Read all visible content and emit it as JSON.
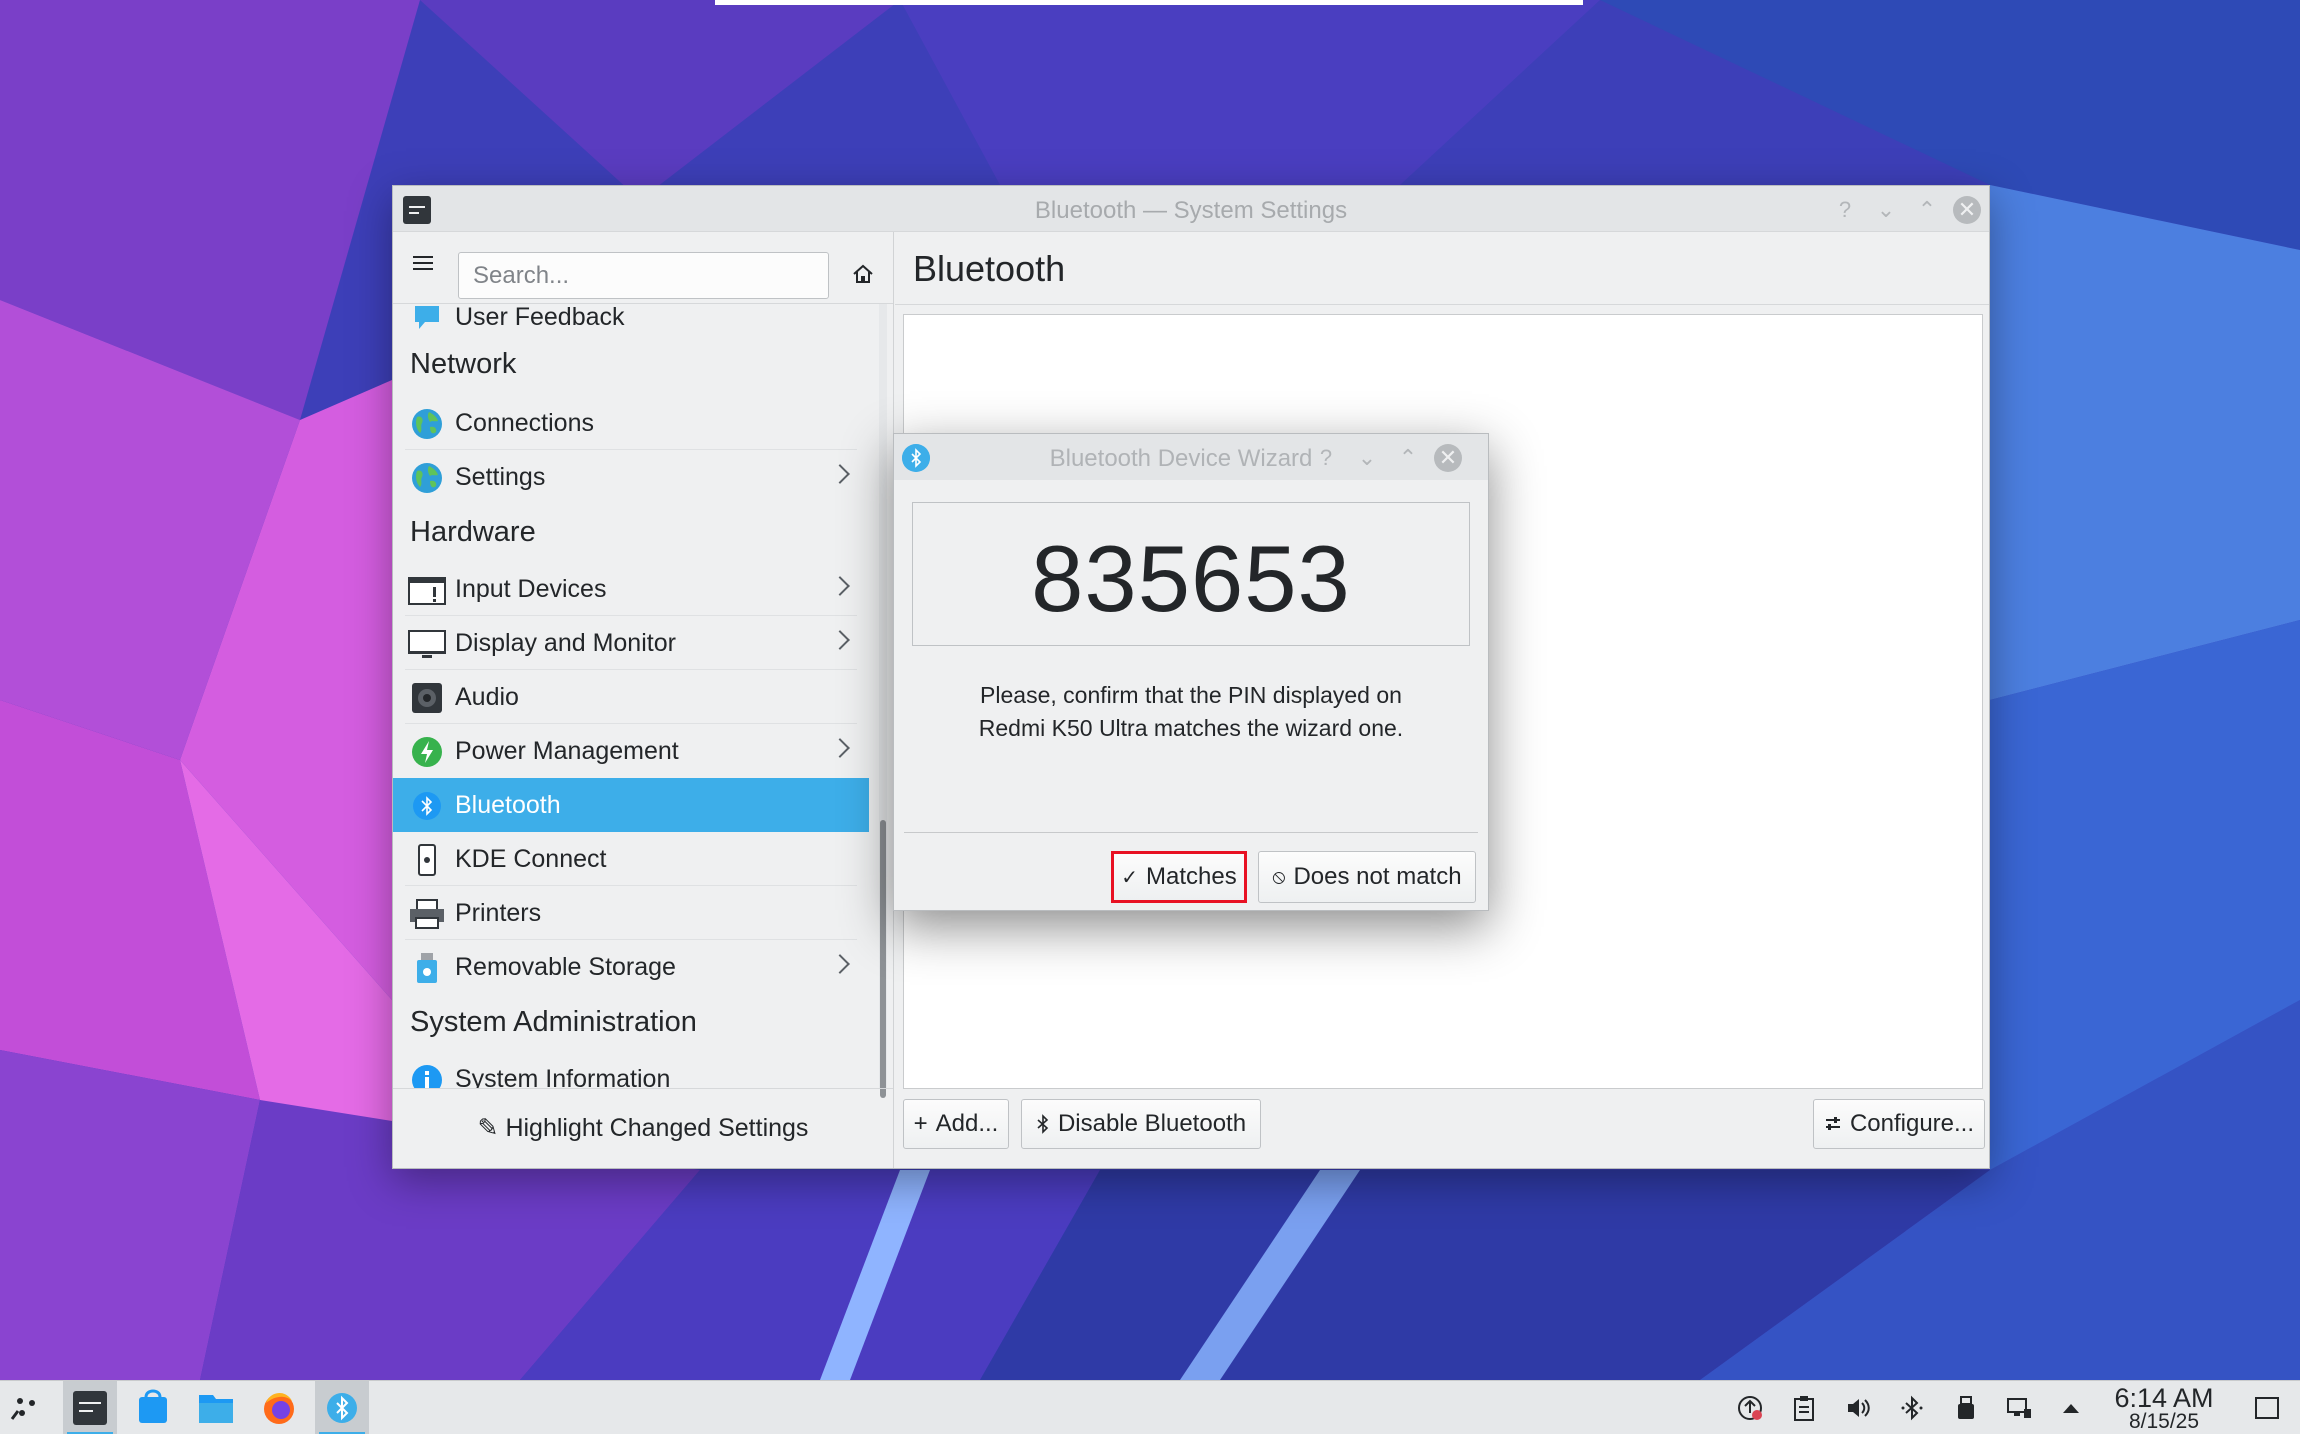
{
  "main_window": {
    "title": "Bluetooth — System Settings",
    "title_buttons": [
      "?",
      "⌄",
      "⌃",
      "✕"
    ]
  },
  "sidebar": {
    "search_placeholder": "Search...",
    "partial_top_item": "User Feedback",
    "categories": {
      "network": "Network",
      "hardware": "Hardware",
      "system_admin": "System Administration"
    },
    "items": {
      "connections": "Connections",
      "settings": "Settings",
      "input_devices": "Input Devices",
      "display_monitor": "Display and Monitor",
      "audio": "Audio",
      "power_management": "Power Management",
      "bluetooth": "Bluetooth",
      "kde_connect": "KDE Connect",
      "printers": "Printers",
      "removable_storage": "Removable Storage",
      "system_information": "System Information"
    },
    "highlight_button": "Highlight Changed Settings"
  },
  "content": {
    "title": "Bluetooth",
    "add_button": "Add...",
    "disable_button": "Disable Bluetooth",
    "configure_button": "Configure..."
  },
  "dialog": {
    "title": "Bluetooth Device Wizard",
    "pin": "835653",
    "message": "Please, confirm that the PIN displayed on Redmi K50 Ultra matches the wizard one.",
    "matches_button": "Matches",
    "no_match_button": "Does not match"
  },
  "taskbar": {
    "time": "6:14 AM",
    "date": "8/15/25"
  },
  "colors": {
    "accent": "#3daee9",
    "highlight_border": "#e81123"
  }
}
